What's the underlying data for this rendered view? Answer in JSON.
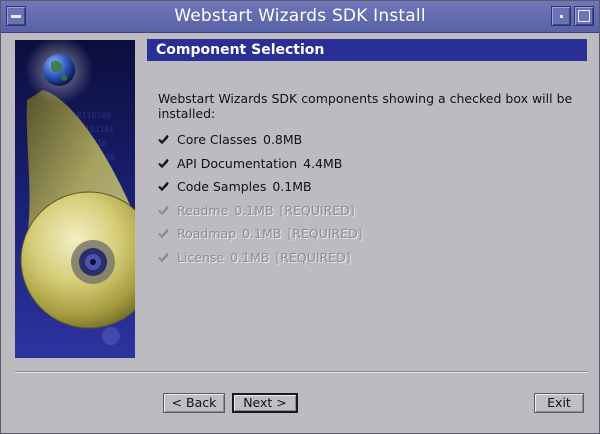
{
  "window": {
    "title": "Webstart Wizards SDK Install"
  },
  "section": {
    "header": "Component Selection",
    "description": "Webstart Wizards SDK components showing a checked box will be installed:"
  },
  "components": [
    {
      "name": "Core Classes",
      "size": "0.8MB",
      "required": "",
      "checked": true,
      "enabled": true
    },
    {
      "name": "API Documentation",
      "size": "4.4MB",
      "required": "",
      "checked": true,
      "enabled": true
    },
    {
      "name": "Code Samples",
      "size": "0.1MB",
      "required": "",
      "checked": true,
      "enabled": true
    },
    {
      "name": "Readme",
      "size": "0.1MB",
      "required": "[REQUIRED]",
      "checked": true,
      "enabled": false
    },
    {
      "name": "Roadmap",
      "size": "0.1MB",
      "required": "[REQUIRED]",
      "checked": true,
      "enabled": false
    },
    {
      "name": "License",
      "size": "0.1MB",
      "required": "[REQUIRED]",
      "checked": true,
      "enabled": false
    }
  ],
  "buttons": {
    "back": "< Back",
    "next": "Next >",
    "exit": "Exit"
  },
  "colors": {
    "titlebar": "#5f67ad",
    "header": "#2a2f96",
    "window_bg": "#bdbbc0"
  }
}
